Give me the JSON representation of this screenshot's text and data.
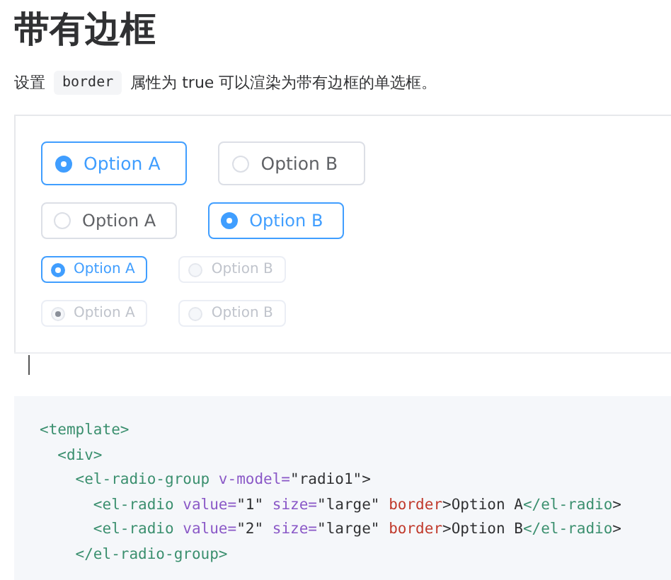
{
  "title": "带有边框",
  "description": [
    {
      "kind": "text",
      "text": "设置"
    },
    {
      "kind": "code",
      "text": "border"
    },
    {
      "kind": "text",
      "text": "属性为 true 可以渲染为带有边框的单选框。"
    }
  ],
  "radio_groups": [
    {
      "kind": "large",
      "options": [
        {
          "label": "Option A",
          "selected": true,
          "disabled": false
        },
        {
          "label": "Option B",
          "selected": false,
          "disabled": false
        }
      ]
    },
    {
      "kind": "default",
      "options": [
        {
          "label": "Option A",
          "selected": false,
          "disabled": false
        },
        {
          "label": "Option B",
          "selected": true,
          "disabled": false
        }
      ]
    },
    {
      "kind": "small",
      "options": [
        {
          "label": "Option A",
          "selected": true,
          "disabled": false
        },
        {
          "label": "Option B",
          "selected": false,
          "disabled": true
        }
      ]
    },
    {
      "kind": "small",
      "options": [
        {
          "label": "Option A",
          "selected": true,
          "disabled": true
        },
        {
          "label": "Option B",
          "selected": false,
          "disabled": true
        }
      ]
    }
  ],
  "code_lines": [
    [
      {
        "kind": "tag",
        "text": "<template>"
      }
    ],
    [
      {
        "kind": "tag",
        "text": "  <div>"
      }
    ],
    [
      {
        "kind": "tag",
        "text": "    <el-radio-group"
      },
      {
        "kind": "attr",
        "text": " v-model="
      },
      {
        "kind": "string",
        "text": "\"radio1\""
      },
      {
        "kind": "plain",
        "text": ">"
      }
    ],
    [
      {
        "kind": "tag",
        "text": "      <el-radio"
      },
      {
        "kind": "attr",
        "text": " value="
      },
      {
        "kind": "string",
        "text": "\"1\""
      },
      {
        "kind": "attr",
        "text": " size="
      },
      {
        "kind": "string",
        "text": "\"large\""
      },
      {
        "kind": "keyword",
        "text": " border"
      },
      {
        "kind": "plain",
        "text": ">Option A"
      },
      {
        "kind": "tag",
        "text": "</el-radio"
      },
      {
        "kind": "plain",
        "text": ">"
      }
    ],
    [
      {
        "kind": "tag",
        "text": "      <el-radio"
      },
      {
        "kind": "attr",
        "text": " value="
      },
      {
        "kind": "string",
        "text": "\"2\""
      },
      {
        "kind": "attr",
        "text": " size="
      },
      {
        "kind": "string",
        "text": "\"large\""
      },
      {
        "kind": "keyword",
        "text": " border"
      },
      {
        "kind": "plain",
        "text": ">Option B"
      },
      {
        "kind": "tag",
        "text": "</el-radio"
      },
      {
        "kind": "plain",
        "text": ">"
      }
    ],
    [
      {
        "kind": "tag",
        "text": "    </el-radio-group>"
      }
    ]
  ]
}
